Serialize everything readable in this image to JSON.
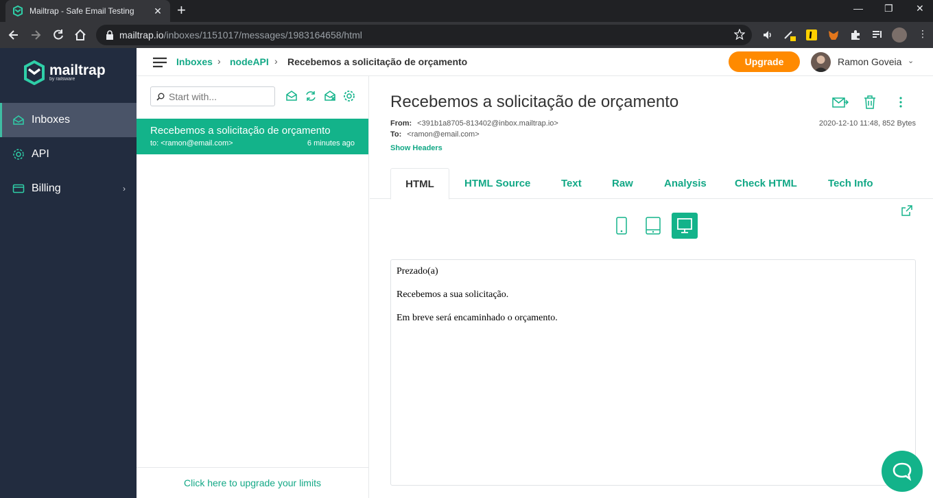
{
  "browser": {
    "tab_title": "Mailtrap - Safe Email Testing",
    "url_host": "mailtrap.io",
    "url_path": "/inboxes/1151017/messages/1983164658/html"
  },
  "app": {
    "logo_text": "mailtrap",
    "logo_sub": "by railsware",
    "nav": [
      {
        "label": "Inboxes",
        "icon": "inbox-icon",
        "active": true
      },
      {
        "label": "API",
        "icon": "gear-icon"
      },
      {
        "label": "Billing",
        "icon": "card-icon"
      }
    ],
    "breadcrumb": {
      "inboxes": "Inboxes",
      "inbox": "nodeAPI",
      "current": "Recebemos a solicitação de orçamento"
    },
    "upgrade_label": "Upgrade",
    "user_name": "Ramon Goveia"
  },
  "list": {
    "search_placeholder": "Start with...",
    "messages": [
      {
        "subject": "Recebemos a solicitação de orçamento",
        "to": "to: <ramon@email.com>",
        "time": "6 minutes ago"
      }
    ],
    "footer": "Click here to upgrade your limits"
  },
  "message": {
    "subject": "Recebemos a solicitação de orçamento",
    "from_label": "From:",
    "from": "<391b1a8705-813402@inbox.mailtrap.io>",
    "to_label": "To:",
    "to": "<ramon@email.com>",
    "date_size": "2020-12-10 11:48, 852 Bytes",
    "show_headers": "Show Headers",
    "tabs": [
      "HTML",
      "HTML Source",
      "Text",
      "Raw",
      "Analysis",
      "Check HTML",
      "Tech Info"
    ],
    "active_tab": "HTML",
    "body": [
      "Prezado(a)",
      "Recebemos a sua solicitação.",
      "Em breve será encaminhado o orçamento."
    ]
  },
  "colors": {
    "accent": "#13b38a",
    "sidebar": "#222c3f",
    "upgrade": "#ff8a00"
  }
}
